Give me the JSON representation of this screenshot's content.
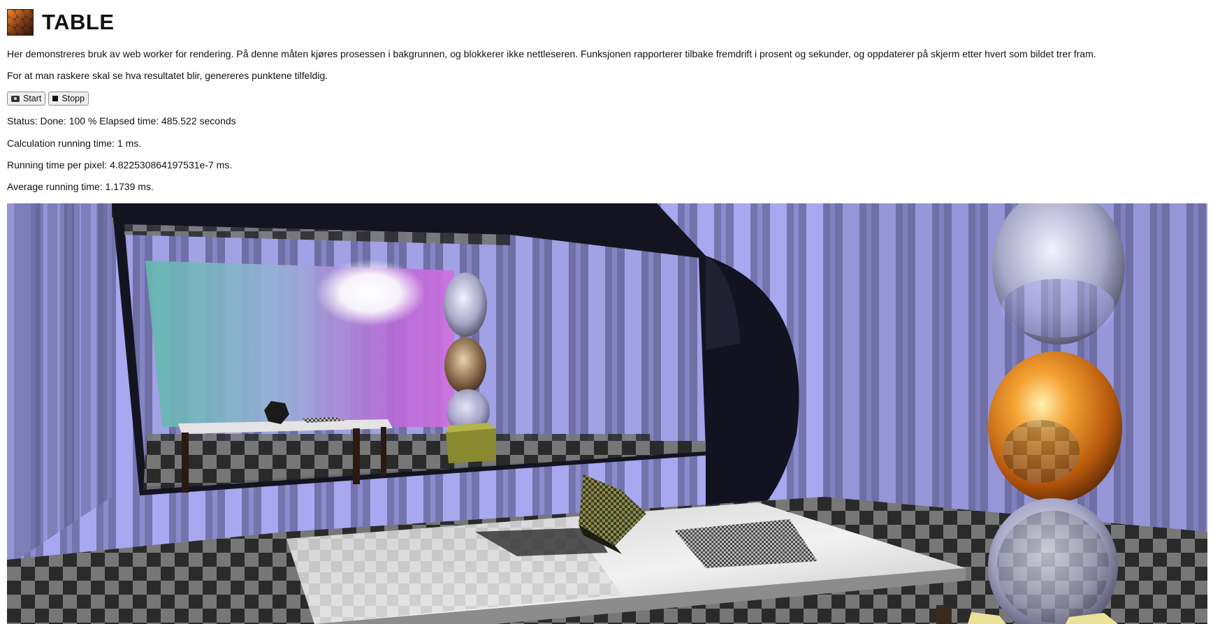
{
  "page": {
    "title": "TABLE",
    "icon": "table-scene-thumbnail-icon",
    "intro": "Her demonstreres bruk av web worker for rendering. På denne måten kjøres prosessen i bakgrunnen, og blokkerer ikke nettleseren. Funksjonen rapporterer tilbake fremdrift i prosent og sekunder, og oppdaterer på skjerm etter hvert som bildet trer fram.",
    "note": "For at man raskere skal se hva resultatet blir, genereres punktene tilfeldig."
  },
  "controls": {
    "start_label": "Start",
    "start_icon": "camera-icon",
    "stop_label": "Stopp",
    "stop_icon": "stop-square-icon"
  },
  "stats": {
    "status": "Status: Done: 100 % Elapsed time: 485.522 seconds",
    "calc_time": "Calculation running time: 1 ms.",
    "per_pixel": "Running time per pixel: 4.822530864197531e-7 ms.",
    "average": "Average running time: 1.1739 ms."
  },
  "colors": {
    "stripe_light": "#a6a6ee",
    "stripe_dark": "#6e6ea6",
    "gold_sphere": "#e88a1c",
    "mirror_cyan": "#7ed0c4",
    "mirror_magenta": "#c060d8"
  }
}
